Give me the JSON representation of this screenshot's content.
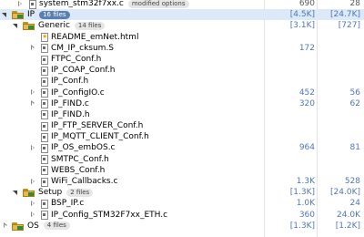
{
  "files": [
    {
      "id": "system",
      "name": "system_stm32f7xx.c",
      "chip": "modified options",
      "chip_style": "gray",
      "twisty": "collapsed",
      "icon": "file-c-icon",
      "c1": "690",
      "c2": "28",
      "c1_bracket": false
    },
    {
      "id": "ip",
      "name": "IP",
      "chip": "16 files",
      "chip_style": "blue",
      "twisty": "expanded",
      "icon": "folder-icon",
      "c1": "[4.5K]",
      "c2": "[24.7K]",
      "selected": true
    },
    {
      "id": "generic",
      "name": "Generic",
      "chip": "14 files",
      "chip_style": "gray",
      "twisty": "expanded",
      "icon": "folder-icon",
      "c1": "[3.1K]",
      "c2": "[727]"
    },
    {
      "id": "readme",
      "name": "README_emNet.html",
      "twisty": "none",
      "icon": "file-html-icon",
      "c1": "",
      "c2": ""
    },
    {
      "id": "cm_ip",
      "name": "CM_IP_cksum.S",
      "twisty": "collapsed",
      "icon": "file-asm-icon",
      "c1": "172",
      "c2": ""
    },
    {
      "id": "ftpc",
      "name": "FTPC_Conf.h",
      "twisty": "none",
      "icon": "file-h-icon",
      "c1": "",
      "c2": ""
    },
    {
      "id": "coap",
      "name": "IP_COAP_Conf.h",
      "twisty": "none",
      "icon": "file-h-icon",
      "c1": "",
      "c2": ""
    },
    {
      "id": "ipconf",
      "name": "IP_Conf.h",
      "twisty": "none",
      "icon": "file-h-icon",
      "c1": "",
      "c2": ""
    },
    {
      "id": "configio",
      "name": "IP_ConfigIO.c",
      "twisty": "collapsed",
      "icon": "file-c-icon",
      "c1": "452",
      "c2": "56"
    },
    {
      "id": "findc",
      "name": "IP_FIND.c",
      "twisty": "collapsed",
      "icon": "file-c-icon",
      "c1": "320",
      "c2": "62"
    },
    {
      "id": "findh",
      "name": "IP_FIND.h",
      "twisty": "none",
      "icon": "file-h-icon",
      "c1": "",
      "c2": ""
    },
    {
      "id": "ftps",
      "name": "IP_FTP_SERVER_Conf.h",
      "twisty": "none",
      "icon": "file-h-icon",
      "c1": "",
      "c2": ""
    },
    {
      "id": "mqtt",
      "name": "IP_MQTT_CLIENT_Conf.h",
      "twisty": "none",
      "icon": "file-h-icon",
      "c1": "",
      "c2": ""
    },
    {
      "id": "embos",
      "name": "IP_OS_embOS.c",
      "twisty": "collapsed",
      "icon": "file-c-icon",
      "c1": "964",
      "c2": "81"
    },
    {
      "id": "smtpc",
      "name": "SMTPC_Conf.h",
      "twisty": "none",
      "icon": "file-h-icon",
      "c1": "",
      "c2": ""
    },
    {
      "id": "webs",
      "name": "WEBS_Conf.h",
      "twisty": "none",
      "icon": "file-h-icon",
      "c1": "",
      "c2": ""
    },
    {
      "id": "wifi",
      "name": "WiFi_Callbacks.c",
      "twisty": "collapsed",
      "icon": "file-c-icon",
      "c1": "1.3K",
      "c2": "528"
    },
    {
      "id": "setup",
      "name": "Setup",
      "chip": "2 files",
      "chip_style": "gray",
      "twisty": "expanded",
      "icon": "folder-icon",
      "c1": "[1.3K]",
      "c2": "[24.0K]"
    },
    {
      "id": "bsp",
      "name": "BSP_IP.c",
      "twisty": "collapsed",
      "icon": "file-c-icon",
      "c1": "1.0K",
      "c2": "24"
    },
    {
      "id": "ipcfg",
      "name": "IP_Config_STM32F7xx_ETH.c",
      "twisty": "collapsed",
      "icon": "file-c-icon",
      "c1": "360",
      "c2": "24.0K"
    },
    {
      "id": "os",
      "name": "OS",
      "chip": "4 files",
      "chip_style": "gray",
      "twisty": "collapsed",
      "icon": "folder-icon",
      "c1": "[1.3K]",
      "c2": "[1.2K]"
    }
  ]
}
